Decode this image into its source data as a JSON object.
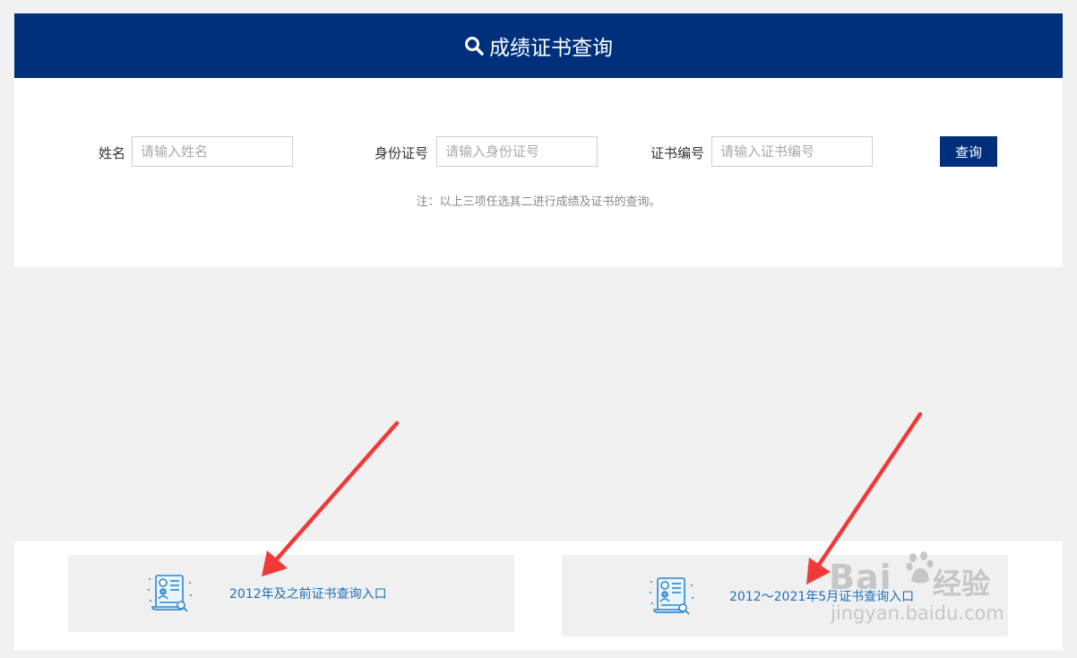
{
  "header": {
    "title": "成绩证书查询"
  },
  "search_form": {
    "name_label": "姓名",
    "name_placeholder": "请输入姓名",
    "id_label": "身份证号",
    "id_placeholder": "请输入身份证号",
    "cert_label": "证书编号",
    "cert_placeholder": "请输入证书编号",
    "query_button": "查询",
    "note": "注：以上三项任选其二进行成绩及证书的查询。"
  },
  "entries": [
    {
      "label": "2012年及之前证书查询入口"
    },
    {
      "label": "2012～2021年5月证书查询入口"
    }
  ],
  "watermark": {
    "brand": "Bai",
    "brand_suffix": "经验",
    "url": "jingyan.baidu.com"
  },
  "colors": {
    "header_bg": "#00307c",
    "link_blue": "#1e6fb8",
    "arrow_red": "#f03a3a"
  }
}
